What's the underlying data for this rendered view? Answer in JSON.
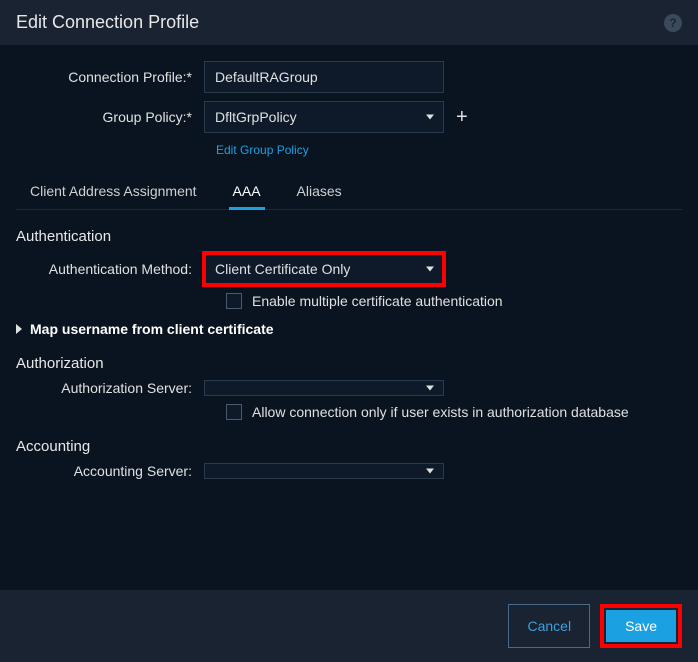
{
  "header": {
    "title": "Edit Connection Profile"
  },
  "form": {
    "profile_label": "Connection Profile:*",
    "profile_value": "DefaultRAGroup",
    "group_policy_label": "Group Policy:*",
    "group_policy_value": "DfltGrpPolicy",
    "edit_group_link": "Edit Group Policy"
  },
  "tabs": {
    "address": "Client Address Assignment",
    "aaa": "AAA",
    "aliases": "Aliases"
  },
  "auth": {
    "section": "Authentication",
    "method_label": "Authentication Method:",
    "method_value": "Client Certificate Only",
    "enable_multi": "Enable multiple certificate authentication",
    "map_user": "Map username from client certificate"
  },
  "authz": {
    "section": "Authorization",
    "server_label": "Authorization Server:",
    "server_value": "",
    "allow_only": "Allow connection only if user exists in authorization database"
  },
  "acct": {
    "section": "Accounting",
    "server_label": "Accounting Server:",
    "server_value": ""
  },
  "footer": {
    "cancel": "Cancel",
    "save": "Save"
  }
}
